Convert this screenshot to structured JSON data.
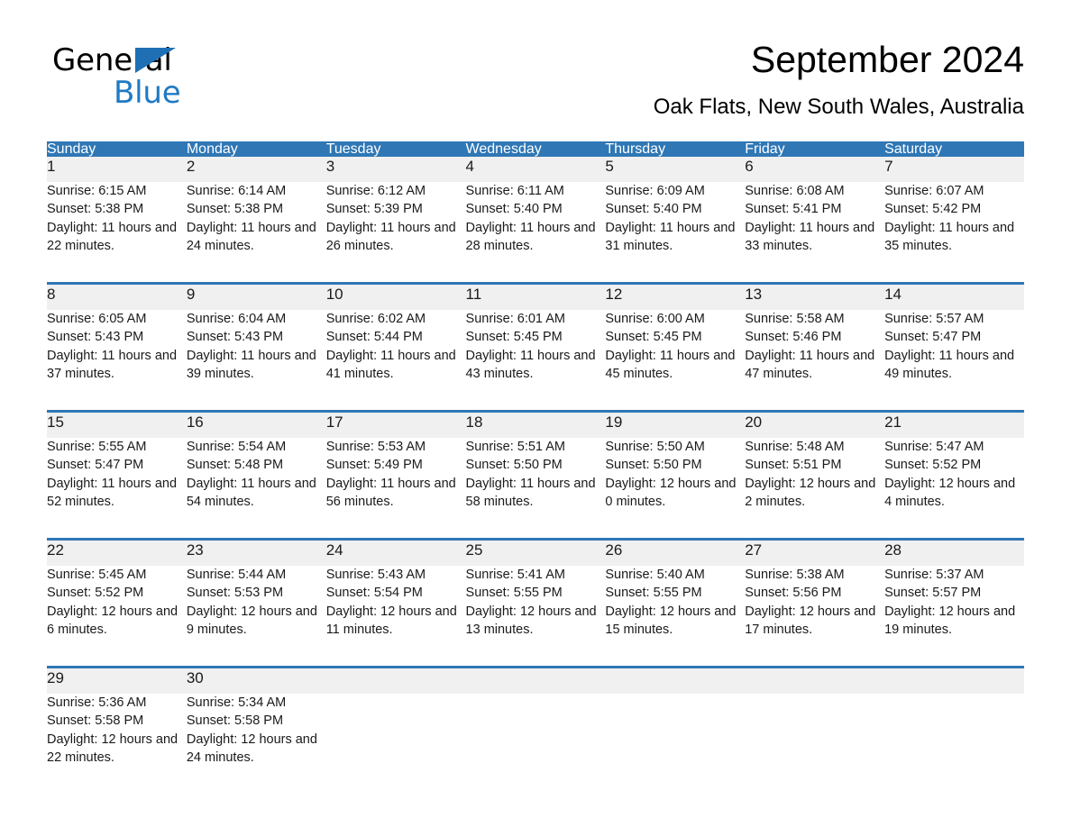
{
  "logo": {
    "word1": "General",
    "word2": "Blue",
    "triangle_color": "#1f6fb5",
    "word2_color": "#1f7ac4"
  },
  "header": {
    "title": "September 2024",
    "subtitle": "Oak Flats, New South Wales, Australia"
  },
  "theme": {
    "header_blue": "#2f77b5",
    "daynum_band": "#f0f0f0",
    "text": "#1a1a1a"
  },
  "weekdays": [
    "Sunday",
    "Monday",
    "Tuesday",
    "Wednesday",
    "Thursday",
    "Friday",
    "Saturday"
  ],
  "labels": {
    "sunrise_prefix": "Sunrise:",
    "sunset_prefix": "Sunset:",
    "daylight_prefix": "Daylight:"
  },
  "weeks": [
    [
      {
        "day": "1",
        "sunrise": "Sunrise: 6:15 AM",
        "sunset": "Sunset: 5:38 PM",
        "daylight": "Daylight: 11 hours and 22 minutes."
      },
      {
        "day": "2",
        "sunrise": "Sunrise: 6:14 AM",
        "sunset": "Sunset: 5:38 PM",
        "daylight": "Daylight: 11 hours and 24 minutes."
      },
      {
        "day": "3",
        "sunrise": "Sunrise: 6:12 AM",
        "sunset": "Sunset: 5:39 PM",
        "daylight": "Daylight: 11 hours and 26 minutes."
      },
      {
        "day": "4",
        "sunrise": "Sunrise: 6:11 AM",
        "sunset": "Sunset: 5:40 PM",
        "daylight": "Daylight: 11 hours and 28 minutes."
      },
      {
        "day": "5",
        "sunrise": "Sunrise: 6:09 AM",
        "sunset": "Sunset: 5:40 PM",
        "daylight": "Daylight: 11 hours and 31 minutes."
      },
      {
        "day": "6",
        "sunrise": "Sunrise: 6:08 AM",
        "sunset": "Sunset: 5:41 PM",
        "daylight": "Daylight: 11 hours and 33 minutes."
      },
      {
        "day": "7",
        "sunrise": "Sunrise: 6:07 AM",
        "sunset": "Sunset: 5:42 PM",
        "daylight": "Daylight: 11 hours and 35 minutes."
      }
    ],
    [
      {
        "day": "8",
        "sunrise": "Sunrise: 6:05 AM",
        "sunset": "Sunset: 5:43 PM",
        "daylight": "Daylight: 11 hours and 37 minutes."
      },
      {
        "day": "9",
        "sunrise": "Sunrise: 6:04 AM",
        "sunset": "Sunset: 5:43 PM",
        "daylight": "Daylight: 11 hours and 39 minutes."
      },
      {
        "day": "10",
        "sunrise": "Sunrise: 6:02 AM",
        "sunset": "Sunset: 5:44 PM",
        "daylight": "Daylight: 11 hours and 41 minutes."
      },
      {
        "day": "11",
        "sunrise": "Sunrise: 6:01 AM",
        "sunset": "Sunset: 5:45 PM",
        "daylight": "Daylight: 11 hours and 43 minutes."
      },
      {
        "day": "12",
        "sunrise": "Sunrise: 6:00 AM",
        "sunset": "Sunset: 5:45 PM",
        "daylight": "Daylight: 11 hours and 45 minutes."
      },
      {
        "day": "13",
        "sunrise": "Sunrise: 5:58 AM",
        "sunset": "Sunset: 5:46 PM",
        "daylight": "Daylight: 11 hours and 47 minutes."
      },
      {
        "day": "14",
        "sunrise": "Sunrise: 5:57 AM",
        "sunset": "Sunset: 5:47 PM",
        "daylight": "Daylight: 11 hours and 49 minutes."
      }
    ],
    [
      {
        "day": "15",
        "sunrise": "Sunrise: 5:55 AM",
        "sunset": "Sunset: 5:47 PM",
        "daylight": "Daylight: 11 hours and 52 minutes."
      },
      {
        "day": "16",
        "sunrise": "Sunrise: 5:54 AM",
        "sunset": "Sunset: 5:48 PM",
        "daylight": "Daylight: 11 hours and 54 minutes."
      },
      {
        "day": "17",
        "sunrise": "Sunrise: 5:53 AM",
        "sunset": "Sunset: 5:49 PM",
        "daylight": "Daylight: 11 hours and 56 minutes."
      },
      {
        "day": "18",
        "sunrise": "Sunrise: 5:51 AM",
        "sunset": "Sunset: 5:50 PM",
        "daylight": "Daylight: 11 hours and 58 minutes."
      },
      {
        "day": "19",
        "sunrise": "Sunrise: 5:50 AM",
        "sunset": "Sunset: 5:50 PM",
        "daylight": "Daylight: 12 hours and 0 minutes."
      },
      {
        "day": "20",
        "sunrise": "Sunrise: 5:48 AM",
        "sunset": "Sunset: 5:51 PM",
        "daylight": "Daylight: 12 hours and 2 minutes."
      },
      {
        "day": "21",
        "sunrise": "Sunrise: 5:47 AM",
        "sunset": "Sunset: 5:52 PM",
        "daylight": "Daylight: 12 hours and 4 minutes."
      }
    ],
    [
      {
        "day": "22",
        "sunrise": "Sunrise: 5:45 AM",
        "sunset": "Sunset: 5:52 PM",
        "daylight": "Daylight: 12 hours and 6 minutes."
      },
      {
        "day": "23",
        "sunrise": "Sunrise: 5:44 AM",
        "sunset": "Sunset: 5:53 PM",
        "daylight": "Daylight: 12 hours and 9 minutes."
      },
      {
        "day": "24",
        "sunrise": "Sunrise: 5:43 AM",
        "sunset": "Sunset: 5:54 PM",
        "daylight": "Daylight: 12 hours and 11 minutes."
      },
      {
        "day": "25",
        "sunrise": "Sunrise: 5:41 AM",
        "sunset": "Sunset: 5:55 PM",
        "daylight": "Daylight: 12 hours and 13 minutes."
      },
      {
        "day": "26",
        "sunrise": "Sunrise: 5:40 AM",
        "sunset": "Sunset: 5:55 PM",
        "daylight": "Daylight: 12 hours and 15 minutes."
      },
      {
        "day": "27",
        "sunrise": "Sunrise: 5:38 AM",
        "sunset": "Sunset: 5:56 PM",
        "daylight": "Daylight: 12 hours and 17 minutes."
      },
      {
        "day": "28",
        "sunrise": "Sunrise: 5:37 AM",
        "sunset": "Sunset: 5:57 PM",
        "daylight": "Daylight: 12 hours and 19 minutes."
      }
    ],
    [
      {
        "day": "29",
        "sunrise": "Sunrise: 5:36 AM",
        "sunset": "Sunset: 5:58 PM",
        "daylight": "Daylight: 12 hours and 22 minutes."
      },
      {
        "day": "30",
        "sunrise": "Sunrise: 5:34 AM",
        "sunset": "Sunset: 5:58 PM",
        "daylight": "Daylight: 12 hours and 24 minutes."
      },
      {
        "day": "",
        "sunrise": "",
        "sunset": "",
        "daylight": ""
      },
      {
        "day": "",
        "sunrise": "",
        "sunset": "",
        "daylight": ""
      },
      {
        "day": "",
        "sunrise": "",
        "sunset": "",
        "daylight": ""
      },
      {
        "day": "",
        "sunrise": "",
        "sunset": "",
        "daylight": ""
      },
      {
        "day": "",
        "sunrise": "",
        "sunset": "",
        "daylight": ""
      }
    ]
  ]
}
